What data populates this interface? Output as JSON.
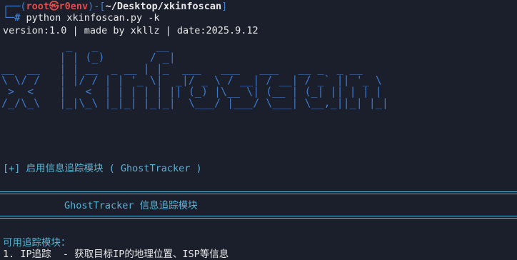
{
  "prompt": {
    "frame_open": "┌──(",
    "user_host": "root㉿r0env",
    "frame_mid": ")-[",
    "cwd": "~/Desktop/xkinfoscan",
    "frame_close": "]",
    "frame_second": "└─",
    "symbol": "#",
    "command": " python xkinfoscan.py -k"
  },
  "version_line": "version:1.0 | made by xkllz | date:2025.9.12",
  "banner_ascii": "          _   _         __\n         | | (_)       / _|\n__  __   | | __  _ __ | |_  ___   ___   ___   __ _  _ __\n\\ \\/ /   | |/ / | | '_ \\|  _|/ _ \\ / __| / __| / _` || '_ \\\n >  <    |   <  | | | | | || (_) |\\__ \\| (__ | (_| || | | |\n/_/\\_\\   |_|\\_\\ |_|_| |_|_|  \\___/ |___/ \\___| \\__,_||_| |_|",
  "info_line": "[+] 启用信息追踪模块 ( GhostTracker )",
  "module_title": "GhostTracker 信息追踪模块",
  "available_label": "可用追踪模块：",
  "items": [
    "1. IP追踪  - 获取目标IP的地理位置、ISP等信息"
  ]
}
